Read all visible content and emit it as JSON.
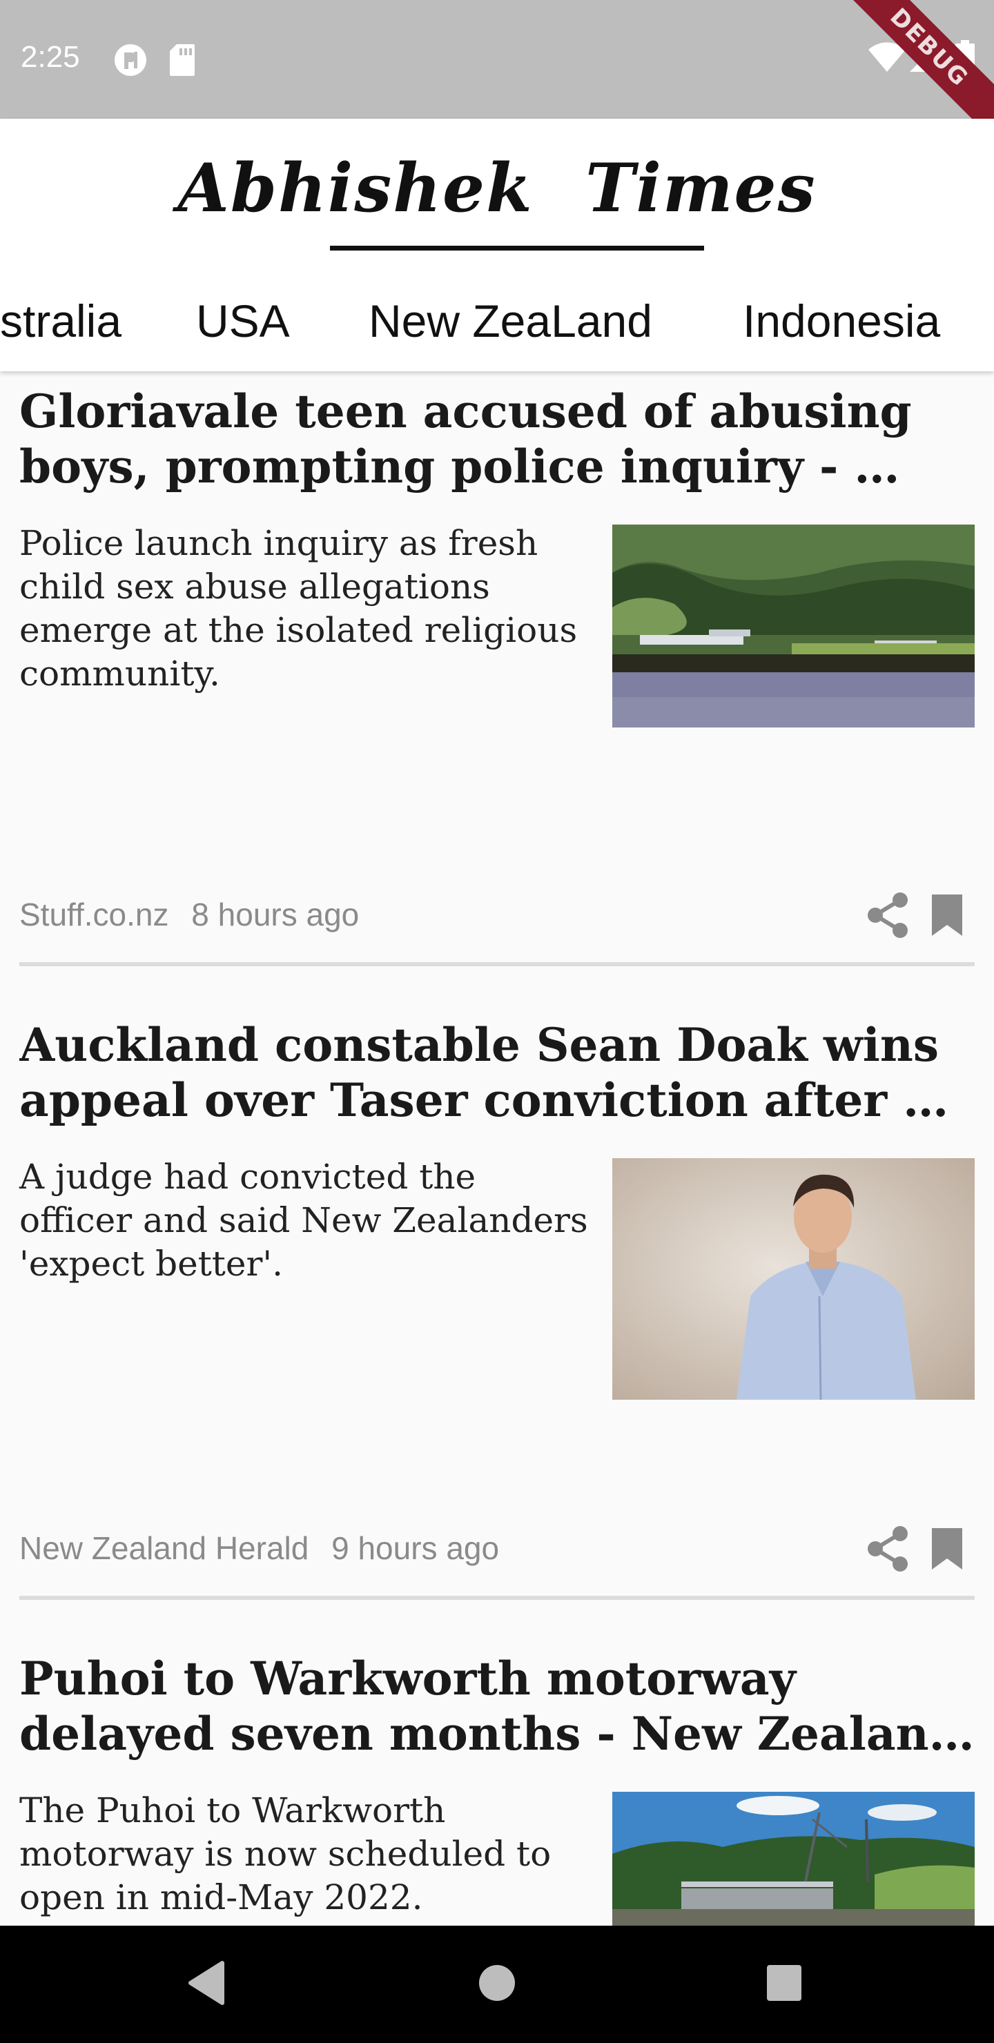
{
  "status_bar": {
    "time": "2:25",
    "debug_label": "DEBUG",
    "icons": [
      "app-notification-icon",
      "sd-card-icon",
      "wifi-icon",
      "signal-icon",
      "battery-icon"
    ]
  },
  "app": {
    "title": "Abhishek Times"
  },
  "tabs": [
    {
      "label": "Australia",
      "visible_label": "stralia",
      "selected": false
    },
    {
      "label": "USA",
      "selected": false
    },
    {
      "label": "New ZeaLand",
      "selected": true
    },
    {
      "label": "Indonesia",
      "selected": false
    }
  ],
  "articles": [
    {
      "headline_line1": "Gloriavale teen accused of abusing",
      "headline_line2": "boys, prompting police inquiry - …",
      "description": "Police launch inquiry as fresh child sex abuse allegations emerge at the isolated religious community.",
      "source": "Stuff.co.nz",
      "time_ago": "8 hours ago",
      "image": "lakeside-settlement-photo"
    },
    {
      "headline_line1": "Auckland constable Sean Doak wins",
      "headline_line2": "appeal over Taser conviction after …",
      "description": "A judge had convicted the officer and said New Zealanders 'expect better'.",
      "source": "New Zealand Herald",
      "time_ago": "9 hours ago",
      "image": "man-in-blue-shirt-photo"
    },
    {
      "headline_line1": "Puhoi to Warkworth motorway",
      "headline_line2": "delayed seven months - New Zealand…",
      "description": "The Puhoi to Warkworth motorway is now scheduled to open in mid-May 2022.",
      "image": "motorway-construction-photo"
    }
  ],
  "nav": {
    "icons": [
      "back-icon",
      "home-icon",
      "recents-icon"
    ]
  },
  "colors": {
    "status_bar": "#bdbdbd",
    "debug_banner": "#8b1a2a",
    "background": "#fafafa",
    "meta_text": "#8a8a8a",
    "icon_grey": "#8a8a8a"
  }
}
